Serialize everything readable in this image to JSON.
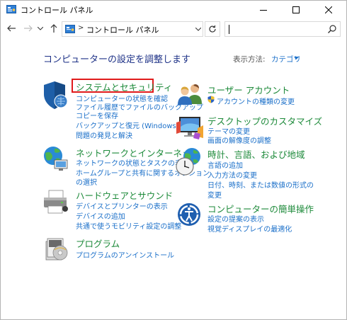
{
  "window": {
    "title": "コントロール パネル"
  },
  "navbar": {
    "address_path": "コントロール パネル",
    "address_separator": ">",
    "search_placeholder": ""
  },
  "content": {
    "heading": "コンピューターの設定を調整します",
    "view_by_label": "表示方法:",
    "view_by_value": "カテゴリ"
  },
  "categories_left": [
    {
      "title": "システムとセキュリティ",
      "icon": "shield-icon",
      "links": [
        "コンピューターの状態を確認",
        "ファイル履歴でファイルのバックアップ",
        "コピーを保存",
        "バックアップと復元 (Windows 7)",
        "問題の発見と解決"
      ]
    },
    {
      "title": "ネットワークとインターネット",
      "icon": "network-globe-icon",
      "links": [
        "ネットワークの状態とタスクの表示",
        "ホームグループと共有に関するオプション",
        "の選択"
      ]
    },
    {
      "title": "ハードウェアとサウンド",
      "icon": "printer-icon",
      "links": [
        "デバイスとプリンターの表示",
        "デバイスの追加",
        "共通で使うモビリティ設定の調整"
      ]
    },
    {
      "title": "プログラム",
      "icon": "programs-icon",
      "links": [
        "プログラムのアンインストール"
      ]
    }
  ],
  "categories_right": [
    {
      "title": "ユーザー アカウント",
      "icon": "users-icon",
      "links": [
        "アカウントの種類の変更"
      ],
      "first_link_icon": "uac-shield-icon"
    },
    {
      "title": "デスクトップのカスタマイズ",
      "icon": "monitor-icon",
      "links": [
        "テーマの変更",
        "画面の解像度の調整"
      ]
    },
    {
      "title": "時計、言語、および地域",
      "icon": "clock-globe-icon",
      "links": [
        "言語の追加",
        "入力方法の変更",
        "日付、時刻、または数値の形式の",
        "変更"
      ]
    },
    {
      "title": "コンピューターの簡単操作",
      "icon": "accessibility-icon",
      "links": [
        "設定の提案の表示",
        "視覚ディスプレイの最適化"
      ]
    }
  ],
  "colors": {
    "category_title": "#1d8a3a",
    "link": "#1a6fc9",
    "heading": "#1e3287",
    "highlight_border": "#e01b1b"
  }
}
